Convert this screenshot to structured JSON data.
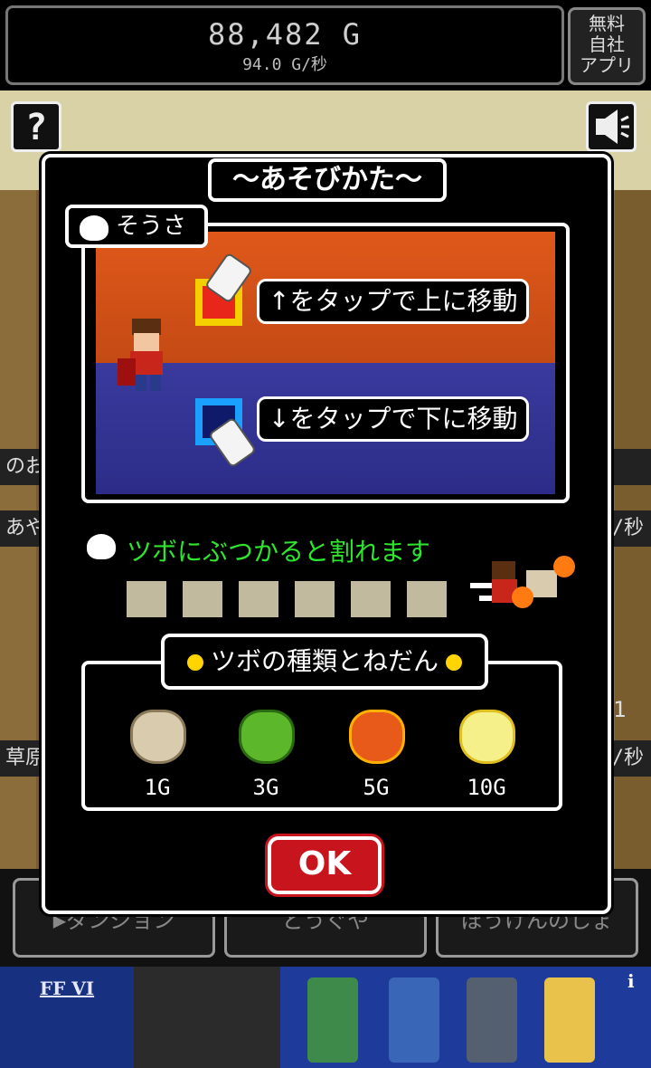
{
  "header": {
    "gold_total": "88,482 G",
    "gold_rate": "94.0 G/秒",
    "free_app_label": "無料\n自社\nアプリ"
  },
  "toolbar": {
    "help_label": "?",
    "sound_icon": "speaker-icon"
  },
  "background": {
    "row1_left": "のお",
    "row2_left": "あや",
    "row2_right": "/秒",
    "row3_left": "草原",
    "row3_right": "/秒",
    "row_counter": "1"
  },
  "bottom_tabs": [
    {
      "label": "▶ダンジョン"
    },
    {
      "label": "どうぐや"
    },
    {
      "label": "ぼうけんのしょ"
    }
  ],
  "ad": {
    "logo": "FF VI",
    "info": "i"
  },
  "dialog": {
    "title": "～あそびかた～",
    "controls_label": "そうさ",
    "instruction_up": "↑をタップで上に移動",
    "instruction_down": "↓をタップで下に移動",
    "crack_text": "ツボにぶつかると割れます",
    "types_label": "ツボの種類とねだん",
    "pots": [
      {
        "price": "1G",
        "color": "#d9ccae"
      },
      {
        "price": "3G",
        "color": "#5cb82a"
      },
      {
        "price": "5G",
        "color": "#e85a1a"
      },
      {
        "price": "10G",
        "color": "#f5f08a"
      }
    ],
    "ok_label": "OK"
  },
  "colors": {
    "accent_red": "#c8141c",
    "text_green": "#2ee62e",
    "bullet_yellow": "#ffd400"
  }
}
